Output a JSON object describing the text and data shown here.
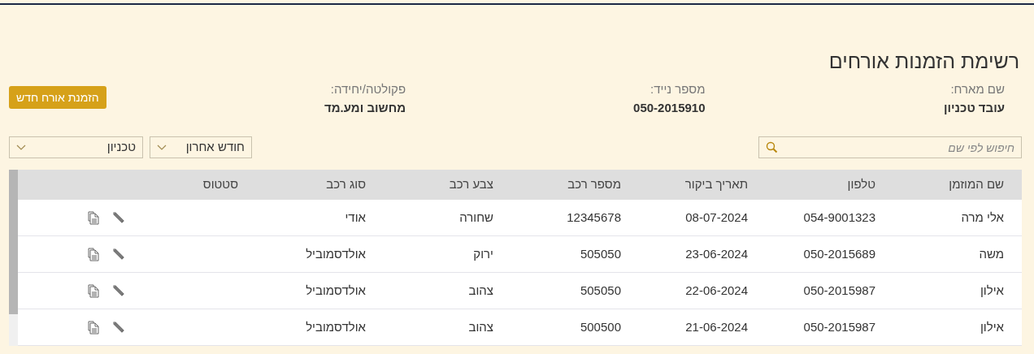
{
  "title": "רשימת הזמנות אורחים",
  "host_info": [
    {
      "label": "שם מארח:",
      "value": "עובד טכניון"
    },
    {
      "label": "מספר נייד:",
      "value": "050-2015910"
    },
    {
      "label": "פקולטה/יחידה:",
      "value": "מחשוב ומע.מד"
    }
  ],
  "new_invite_button": "הזמנת אורח חדש",
  "search": {
    "placeholder": "חיפוש לפי שם"
  },
  "filters": [
    {
      "value": "חודש אחרון"
    },
    {
      "value": "טכניון"
    }
  ],
  "table": {
    "columns": [
      "שם המוזמן",
      "טלפון",
      "תאריך ביקור",
      "מספר רכב",
      "צבע רכב",
      "סוג רכב",
      "סטטוס"
    ],
    "rows": [
      {
        "cells": [
          "אלי מרה",
          "054-9001323",
          "08-07-2024",
          "12345678",
          "שחורה",
          "אודי",
          ""
        ]
      },
      {
        "cells": [
          "משה",
          "050-2015689",
          "23-06-2024",
          "505050",
          "ירוק",
          "אולדסמוביל",
          ""
        ]
      },
      {
        "cells": [
          "אילון",
          "050-2015987",
          "22-06-2024",
          "505050",
          "צהוב",
          "אולדסמוביל",
          ""
        ]
      },
      {
        "cells": [
          "אילון",
          "050-2015987",
          "21-06-2024",
          "500500",
          "צהוב",
          "אולדסמוביל",
          ""
        ]
      }
    ]
  }
}
